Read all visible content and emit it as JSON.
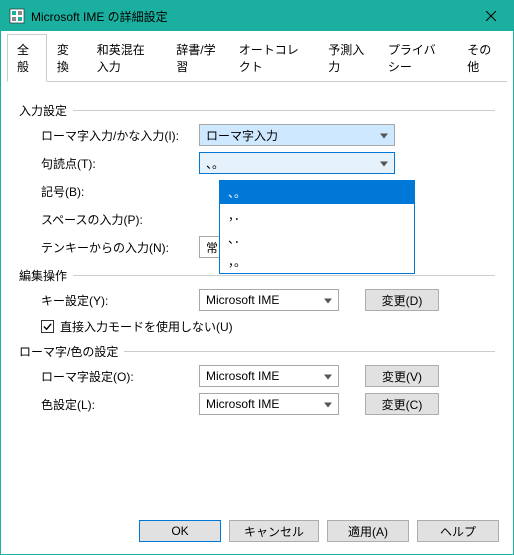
{
  "window": {
    "title": "Microsoft IME の詳細設定"
  },
  "tabs": [
    "全般",
    "変換",
    "和英混在入力",
    "辞書/学習",
    "オートコレクト",
    "予測入力",
    "プライバシー",
    "その他"
  ],
  "active_tab": 0,
  "groups": {
    "input": {
      "title": "入力設定",
      "romaji_kana": {
        "label": "ローマ字入力/かな入力(I):",
        "value": "ローマ字入力"
      },
      "punctuation": {
        "label": "句読点(T):",
        "value": "、。",
        "options": [
          "、。",
          "，．",
          "、．",
          "，。"
        ]
      },
      "symbols": {
        "label": "記号(B):",
        "value": ""
      },
      "space": {
        "label": "スペースの入力(P):",
        "value": ""
      },
      "tenkey": {
        "label": "テンキーからの入力(N):",
        "value": "常に半角"
      }
    },
    "edit": {
      "title": "編集操作",
      "keyset": {
        "label": "キー設定(Y):",
        "value": "Microsoft IME",
        "change": "変更(D)"
      },
      "direct_mode": {
        "label": "直接入力モードを使用しない(U)",
        "checked": true
      }
    },
    "romaji_color": {
      "title": "ローマ字/色の設定",
      "romaji": {
        "label": "ローマ字設定(O):",
        "value": "Microsoft IME",
        "change": "変更(V)"
      },
      "color": {
        "label": "色設定(L):",
        "value": "Microsoft IME",
        "change": "変更(C)"
      }
    }
  },
  "footer": {
    "ok": "OK",
    "cancel": "キャンセル",
    "apply": "適用(A)",
    "help": "ヘルプ"
  }
}
